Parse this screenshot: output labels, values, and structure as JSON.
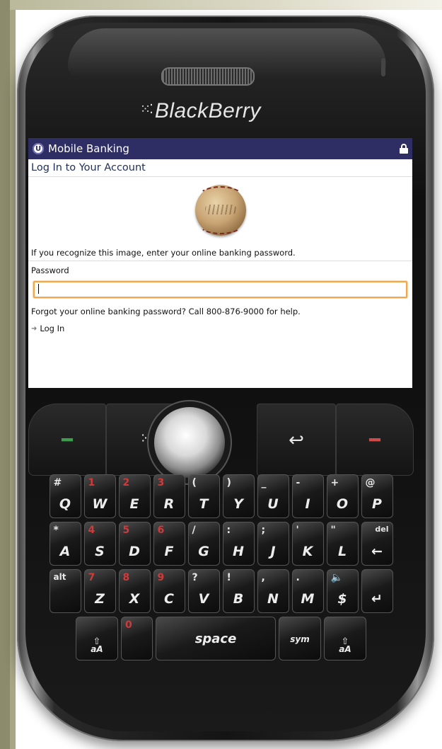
{
  "device": {
    "brand": "BlackBerry",
    "brand_dots": "⁙⁚"
  },
  "app": {
    "title": "Mobile Banking",
    "icon": "bank-logo-icon",
    "secure_icon": "lock-icon",
    "header_color": "#2f2e64"
  },
  "login": {
    "heading": "Log In to Your Account",
    "image_icon": "baseball-image",
    "instruction": "If you recognize this image, enter your online banking password.",
    "password_label": "Password",
    "password_value": "",
    "input_focus_color": "#f2a650",
    "forgot_text": "Forgot your online banking password? Call 800-876-9000 for help.",
    "login_link": "Log In"
  },
  "nav_keys": {
    "call": "call-icon",
    "menu": "menu-icon",
    "back": "back-icon",
    "end": "end-call-icon"
  },
  "keyboard": {
    "rows": [
      [
        {
          "main": "Q",
          "sec": "#",
          "sec_color": "white"
        },
        {
          "main": "W",
          "sec": "1",
          "sec_color": "red"
        },
        {
          "main": "E",
          "sec": "2",
          "sec_color": "red"
        },
        {
          "main": "R",
          "sec": "3",
          "sec_color": "red"
        },
        {
          "main": "T",
          "sec": "(",
          "sec_color": "white"
        },
        {
          "main": "Y",
          "sec": ")",
          "sec_color": "white"
        },
        {
          "main": "U",
          "sec": "_",
          "sec_color": "white"
        },
        {
          "main": "I",
          "sec": "-",
          "sec_color": "white"
        },
        {
          "main": "O",
          "sec": "+",
          "sec_color": "white"
        },
        {
          "main": "P",
          "sec": "@",
          "sec_color": "white"
        }
      ],
      [
        {
          "main": "A",
          "sec": "*",
          "sec_color": "white"
        },
        {
          "main": "S",
          "sec": "4",
          "sec_color": "red"
        },
        {
          "main": "D",
          "sec": "5",
          "sec_color": "red"
        },
        {
          "main": "F",
          "sec": "6",
          "sec_color": "red"
        },
        {
          "main": "G",
          "sec": "/",
          "sec_color": "white"
        },
        {
          "main": "H",
          "sec": ":",
          "sec_color": "white"
        },
        {
          "main": "J",
          "sec": ";",
          "sec_color": "white"
        },
        {
          "main": "K",
          "sec": "'",
          "sec_color": "white"
        },
        {
          "main": "L",
          "sec": "\"",
          "sec_color": "white"
        },
        {
          "main": "←",
          "sec": "del",
          "sec_color": "white"
        }
      ],
      [
        {
          "main": "",
          "sec": "alt",
          "sec_color": "white"
        },
        {
          "main": "Z",
          "sec": "7",
          "sec_color": "red"
        },
        {
          "main": "X",
          "sec": "8",
          "sec_color": "red"
        },
        {
          "main": "C",
          "sec": "9",
          "sec_color": "red"
        },
        {
          "main": "V",
          "sec": "?",
          "sec_color": "white"
        },
        {
          "main": "B",
          "sec": "!",
          "sec_color": "white"
        },
        {
          "main": "N",
          "sec": ",",
          "sec_color": "white"
        },
        {
          "main": "M",
          "sec": ".",
          "sec_color": "white"
        },
        {
          "main": "$",
          "sec": "🔈",
          "sec_color": "red"
        },
        {
          "main": "↵",
          "sec": "",
          "sec_color": "white"
        }
      ]
    ],
    "bottom": {
      "shift_left": "aA",
      "zero": "0",
      "space": "space",
      "sym": "sym",
      "shift_right": "aA"
    }
  }
}
